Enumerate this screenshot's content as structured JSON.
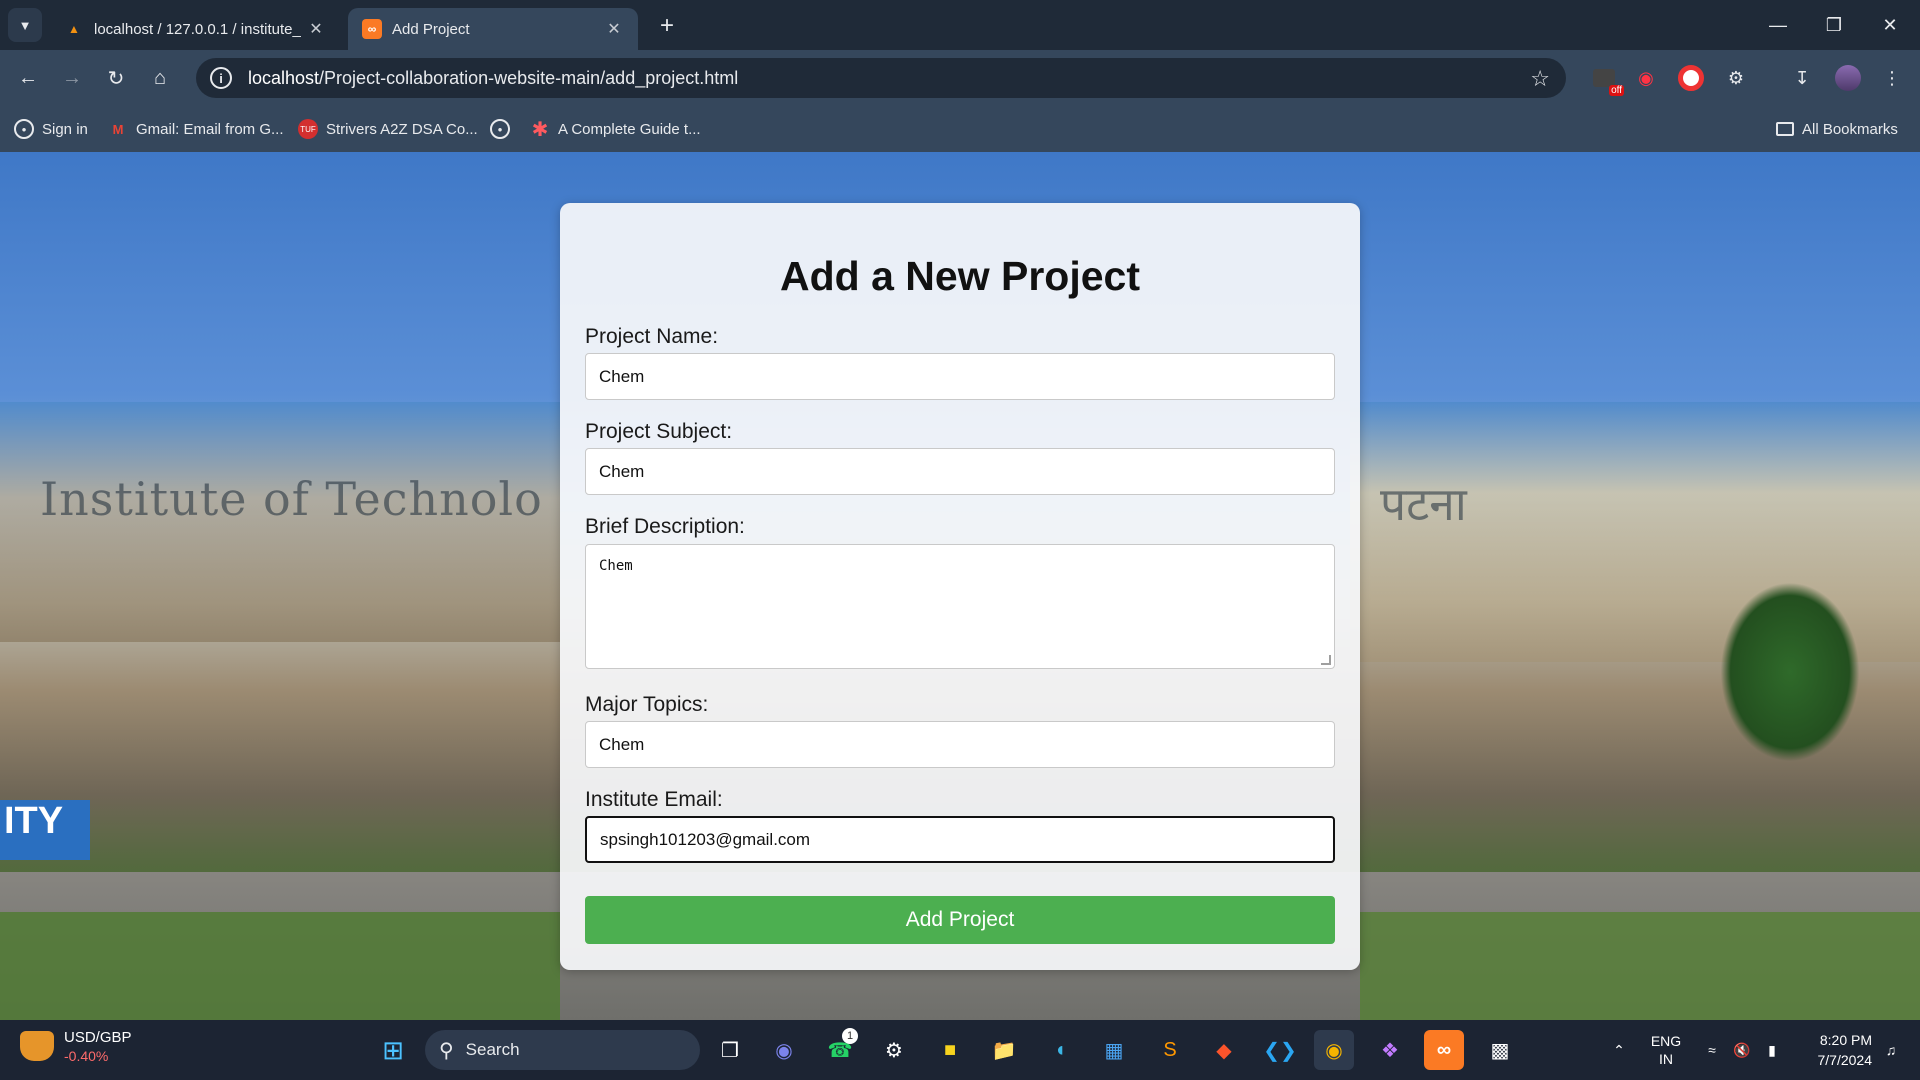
{
  "tabs": [
    {
      "title": "localhost / 127.0.0.1 / institute_",
      "favicon": "phpmyadmin-icon",
      "active": false
    },
    {
      "title": "Add Project",
      "favicon": "xampp-icon",
      "active": true
    }
  ],
  "toolbar": {
    "url_host": "localhost",
    "url_path": "/Project-collaboration-website-main/add_project.html"
  },
  "bookmarks": [
    {
      "label": "Sign in",
      "icon": "globe-icon"
    },
    {
      "label": "Gmail: Email from G...",
      "icon": "gmail-icon"
    },
    {
      "label": "Strivers A2Z DSA Co...",
      "icon": "tuf-icon"
    },
    {
      "label": "",
      "icon": "globe-icon"
    },
    {
      "label": "A Complete Guide t...",
      "icon": "asterisk-icon"
    }
  ],
  "all_bookmarks_label": "All Bookmarks",
  "extension_badge": "off",
  "form": {
    "title": "Add a New Project",
    "project_name_label": "Project Name:",
    "project_name_value": "Chem",
    "project_subject_label": "Project Subject:",
    "project_subject_value": "Chem",
    "description_label": "Brief Description:",
    "description_value": "Chem",
    "topics_label": "Major Topics:",
    "topics_value": "Chem",
    "email_label": "Institute Email:",
    "email_value": "spsingh101203@gmail.com",
    "submit_label": "Add Project"
  },
  "background": {
    "left_text": "Institute of Technolo",
    "right_text": "पटना",
    "sign_text": "ITY"
  },
  "taskbar": {
    "ticker": "USD/GBP",
    "ticker_change": "-0.40%",
    "search_label": "Search",
    "whatsapp_badge": "1",
    "lang_line1": "ENG",
    "lang_line2": "IN",
    "time": "8:20 PM",
    "date": "7/7/2024"
  },
  "colors": {
    "submit_button": "#4caf50",
    "browser_frame": "#35475c",
    "tabstrip": "#1f2a38",
    "taskbar": "#1c2433"
  }
}
